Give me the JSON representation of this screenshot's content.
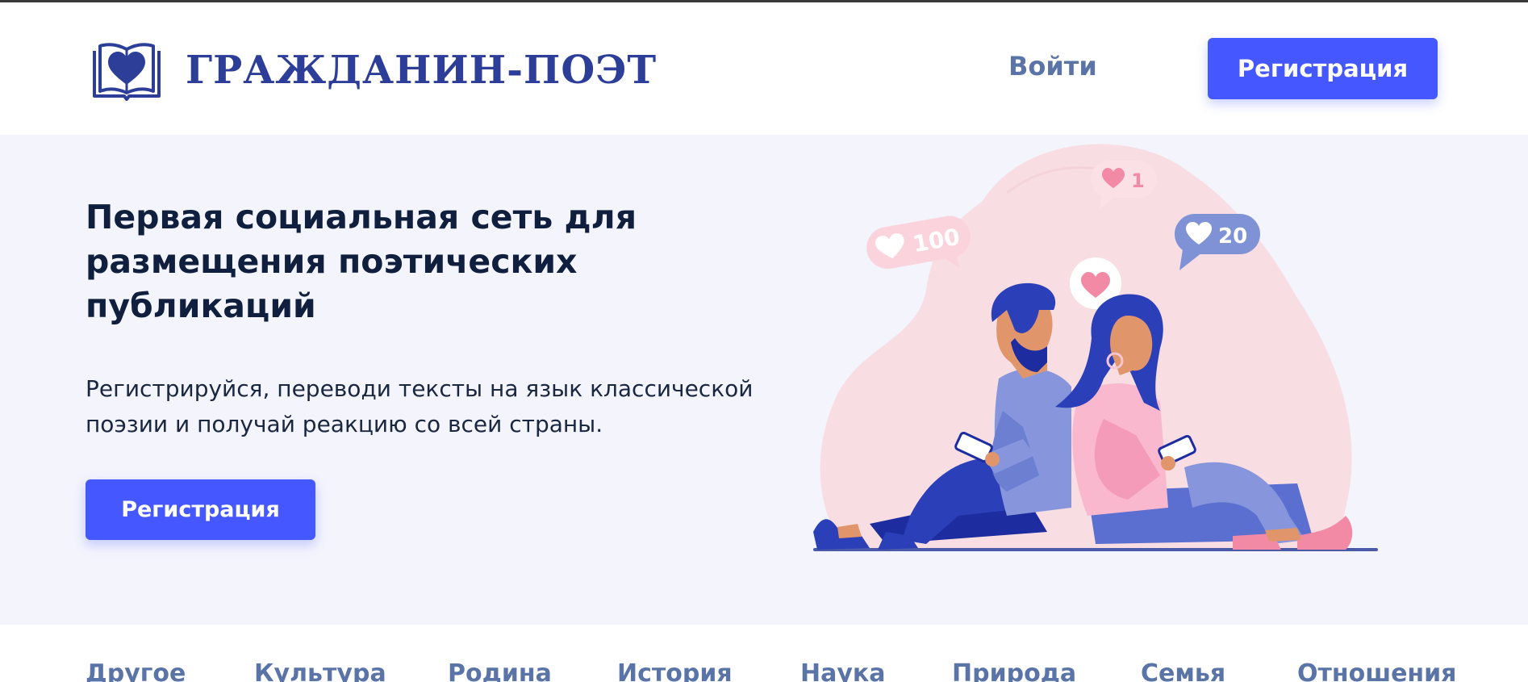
{
  "header": {
    "brand_name": "ГРАЖДАНИН-ПОЭТ",
    "logo_icon": "book-heart-icon",
    "login_label": "Войти",
    "register_label": "Регистрация"
  },
  "hero": {
    "title": "Первая социальная сеть для размещения поэтических публикаций",
    "description": "Регистрируйся, переводи тексты на язык классической поэзии и получай реакцию со всей страны.",
    "register_label": "Регистрация",
    "illustration": {
      "bubbles": [
        {
          "icon": "heart-icon",
          "count": "100"
        },
        {
          "icon": "heart-icon",
          "count": "1"
        },
        {
          "icon": "heart-icon",
          "count": "20"
        },
        {
          "icon": "heart-icon",
          "count": ""
        }
      ]
    }
  },
  "categories": [
    {
      "label": "Другое"
    },
    {
      "label": "Культура"
    },
    {
      "label": "Родина"
    },
    {
      "label": "История"
    },
    {
      "label": "Наука"
    },
    {
      "label": "Природа"
    },
    {
      "label": "Семья"
    },
    {
      "label": "Отношения"
    }
  ],
  "colors": {
    "accent": "#4558ff",
    "brand": "#2c3e98",
    "link": "#5b74a8",
    "hero_bg": "#f3f4fc",
    "title": "#0f1f3d"
  }
}
